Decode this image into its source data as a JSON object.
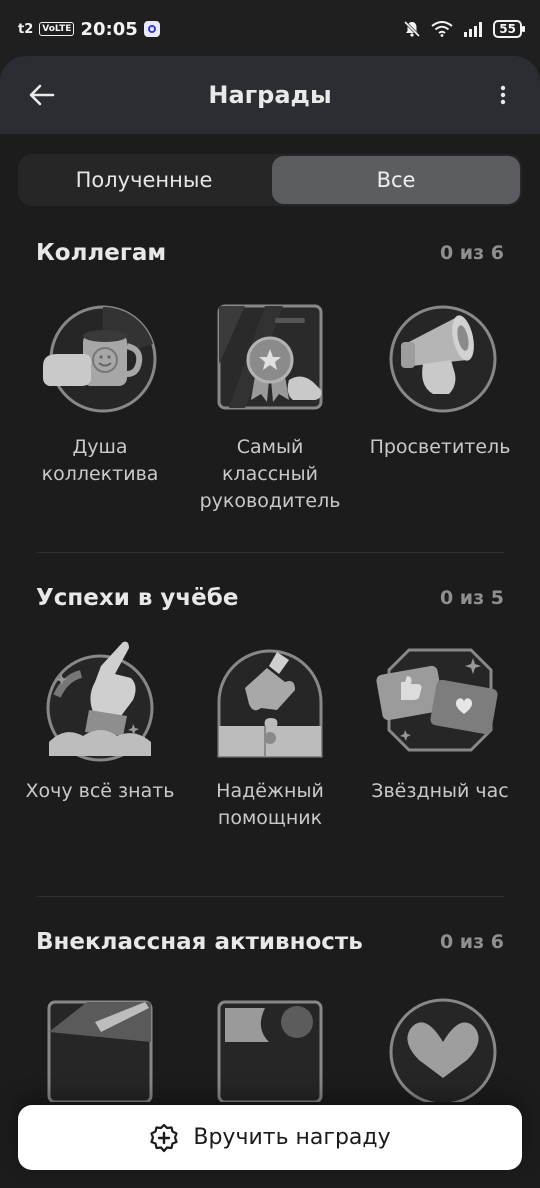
{
  "status_bar": {
    "carrier": "t2",
    "volte": "VoLTE",
    "time": "20:05",
    "battery": "55"
  },
  "header": {
    "title": "Награды"
  },
  "tabs": [
    {
      "label": "Полученные",
      "active": false
    },
    {
      "label": "Все",
      "active": true
    }
  ],
  "sections": [
    {
      "title": "Коллегам",
      "count": "0 из 6",
      "badges": [
        {
          "label": "Душа коллектива",
          "icon": "mug-icon"
        },
        {
          "label": "Самый классный руководитель",
          "icon": "ribbon-medal-icon"
        },
        {
          "label": "Просветитель",
          "icon": "megaphone-icon"
        }
      ]
    },
    {
      "title": "Успехи в учёбе",
      "count": "0 из 5",
      "badges": [
        {
          "label": "Хочу всё знать",
          "icon": "pointing-hand-icon"
        },
        {
          "label": "Надёжный помощник",
          "icon": "puzzle-icon"
        },
        {
          "label": "Звёздный час",
          "icon": "like-cards-icon"
        }
      ]
    },
    {
      "title": "Внеклассная активность",
      "count": "0 из 6",
      "badges": []
    }
  ],
  "cta": {
    "label": "Вручить награду",
    "icon": "plus-badge-icon"
  }
}
